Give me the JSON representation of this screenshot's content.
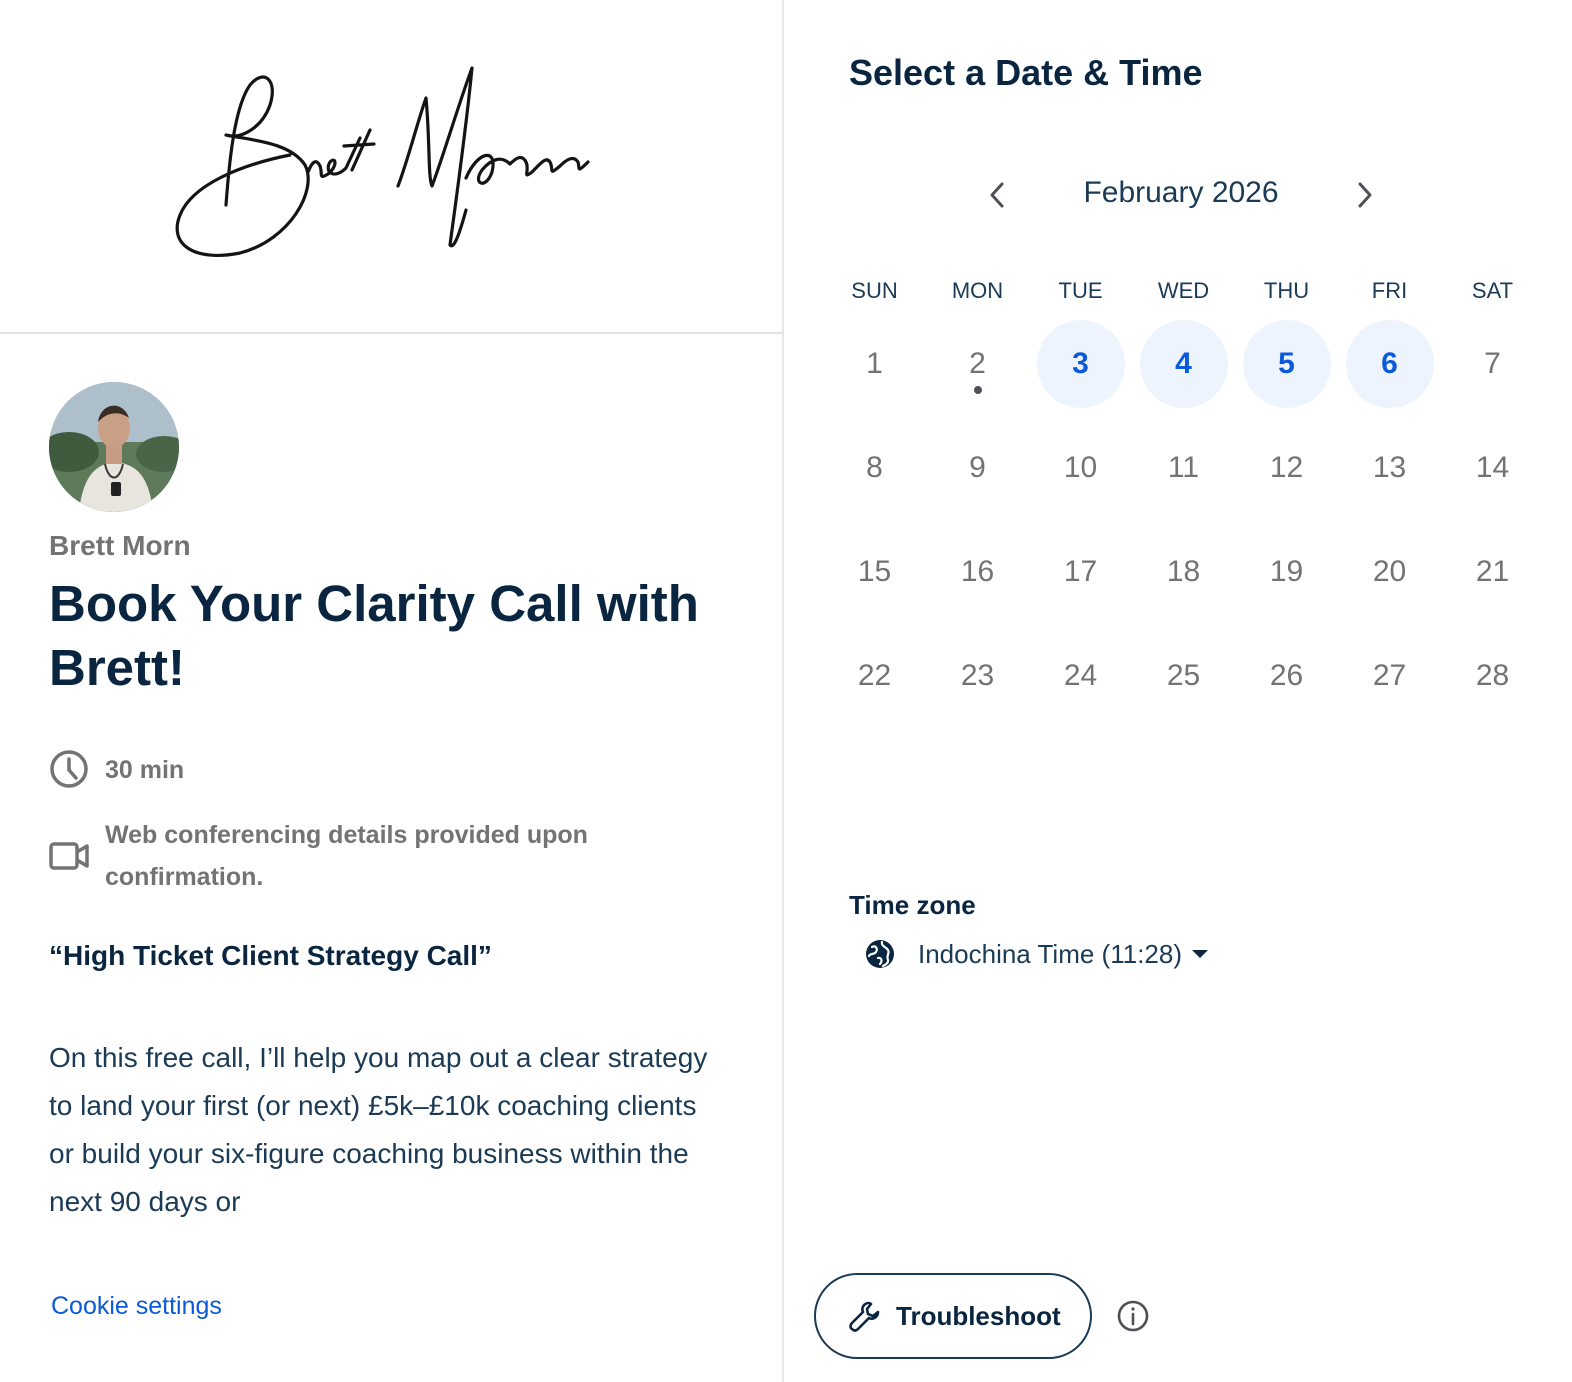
{
  "brand": {
    "signature": "Brett Moran"
  },
  "event": {
    "host_name": "Brett Morn",
    "title": "Book Your Clarity Call with Brett!",
    "duration": "30 min",
    "location_note": "Web conferencing details provided upon confirmation.",
    "quote": "“High Ticket Client Strategy Call”",
    "description": "On this free call, I’ll help you map out a clear strategy to land your first (or next) £5k–£10k coaching clients or build your six-figure coaching business within the next 90 days or"
  },
  "footer": {
    "cookie_settings": "Cookie settings"
  },
  "scheduler": {
    "title": "Select a Date & Time",
    "month_label": "February 2026",
    "prev_icon": "chevron-left-icon",
    "next_icon": "chevron-right-icon",
    "weekdays": [
      "SUN",
      "MON",
      "TUE",
      "WED",
      "THU",
      "FRI",
      "SAT"
    ],
    "weeks": [
      [
        {
          "day": "1",
          "available": false
        },
        {
          "day": "2",
          "available": false,
          "today": true
        },
        {
          "day": "3",
          "available": true
        },
        {
          "day": "4",
          "available": true
        },
        {
          "day": "5",
          "available": true
        },
        {
          "day": "6",
          "available": true
        },
        {
          "day": "7",
          "available": false
        }
      ],
      [
        {
          "day": "8",
          "available": false
        },
        {
          "day": "9",
          "available": false
        },
        {
          "day": "10",
          "available": false
        },
        {
          "day": "11",
          "available": false
        },
        {
          "day": "12",
          "available": false
        },
        {
          "day": "13",
          "available": false
        },
        {
          "day": "14",
          "available": false
        }
      ],
      [
        {
          "day": "15",
          "available": false
        },
        {
          "day": "16",
          "available": false
        },
        {
          "day": "17",
          "available": false
        },
        {
          "day": "18",
          "available": false
        },
        {
          "day": "19",
          "available": false
        },
        {
          "day": "20",
          "available": false
        },
        {
          "day": "21",
          "available": false
        }
      ],
      [
        {
          "day": "22",
          "available": false
        },
        {
          "day": "23",
          "available": false
        },
        {
          "day": "24",
          "available": false
        },
        {
          "day": "25",
          "available": false
        },
        {
          "day": "26",
          "available": false
        },
        {
          "day": "27",
          "available": false
        },
        {
          "day": "28",
          "available": false
        }
      ]
    ],
    "timezone_label": "Time zone",
    "timezone_value": "Indochina Time (11:28)",
    "troubleshoot_label": "Troubleshoot"
  },
  "colors": {
    "primary_text": "#0a2540",
    "link_blue": "#0b5ad9",
    "available_bg": "#eef4fd",
    "muted_gray": "#737373"
  }
}
